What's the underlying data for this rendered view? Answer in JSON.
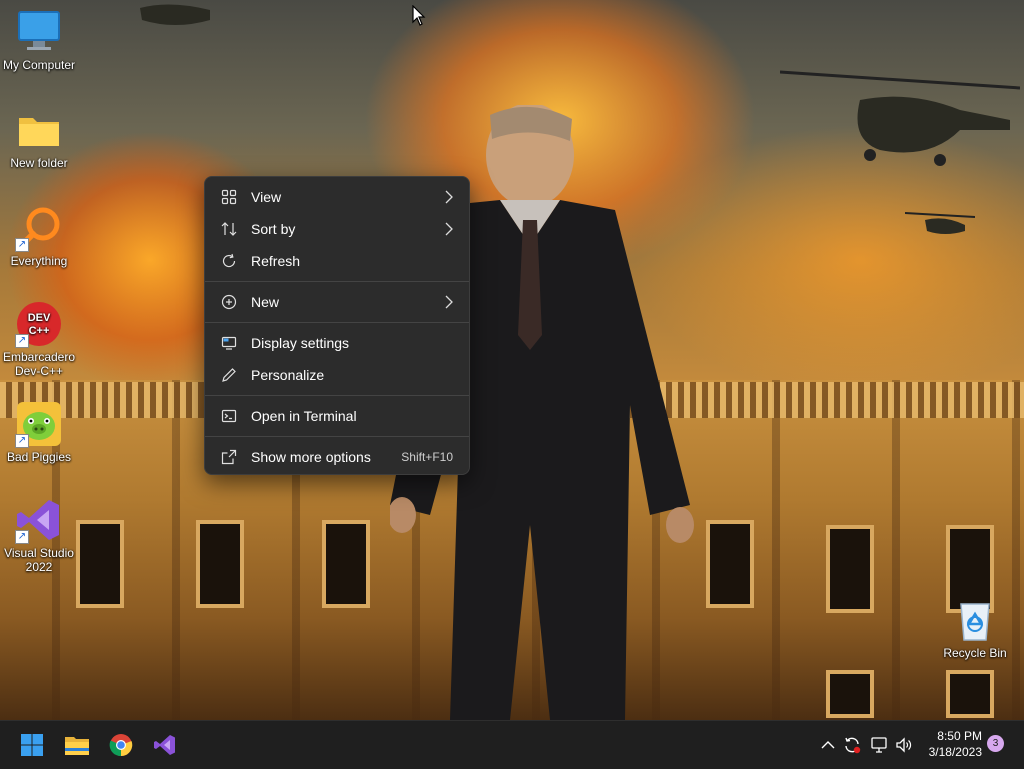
{
  "desktop": {
    "icons": [
      {
        "label": "My Computer",
        "icon": "monitor-icon",
        "shortcut": false
      },
      {
        "label": "New folder",
        "icon": "folder-icon",
        "shortcut": false
      },
      {
        "label": "Everything",
        "icon": "magnifier-icon",
        "shortcut": true
      },
      {
        "label": "Embarcadero Dev-C++",
        "icon": "devcpp-icon",
        "badge": "DEV C++",
        "shortcut": true
      },
      {
        "label": "Bad Piggies",
        "icon": "pig-icon",
        "shortcut": true
      },
      {
        "label": "Visual Studio 2022",
        "icon": "visual-studio-icon",
        "shortcut": true
      },
      {
        "label": "Recycle Bin",
        "icon": "recycle-bin-icon",
        "shortcut": false
      }
    ]
  },
  "context_menu": {
    "items": [
      {
        "label": "View",
        "icon": "grid-icon",
        "submenu": true
      },
      {
        "label": "Sort by",
        "icon": "sort-icon",
        "submenu": true
      },
      {
        "label": "Refresh",
        "icon": "refresh-icon",
        "submenu": false
      },
      {
        "label": "New",
        "icon": "plus-circle-icon",
        "submenu": true
      },
      {
        "label": "Display settings",
        "icon": "display-icon",
        "submenu": false
      },
      {
        "label": "Personalize",
        "icon": "pen-icon",
        "submenu": false
      },
      {
        "label": "Open in Terminal",
        "icon": "terminal-icon",
        "submenu": false
      },
      {
        "label": "Show more options",
        "icon": "share-icon",
        "submenu": false,
        "accelerator": "Shift+F10"
      }
    ]
  },
  "taskbar": {
    "apps": [
      {
        "name": "Start",
        "icon": "windows-start-icon"
      },
      {
        "name": "File Explorer",
        "icon": "file-explorer-icon"
      },
      {
        "name": "Google Chrome",
        "icon": "chrome-icon"
      },
      {
        "name": "Visual Studio",
        "icon": "visual-studio-icon"
      }
    ],
    "tray": {
      "icons": [
        "chevron-up-icon",
        "sync-icon",
        "network-icon",
        "speaker-icon"
      ],
      "time": "8:50 PM",
      "date": "3/18/2023",
      "notification_count": "3"
    }
  },
  "colors": {
    "menu_bg": "#2c2c2c",
    "taskbar_bg": "#1f1f1f",
    "accent_blue": "#0078d4",
    "notification_badge": "#d7a8ee"
  }
}
